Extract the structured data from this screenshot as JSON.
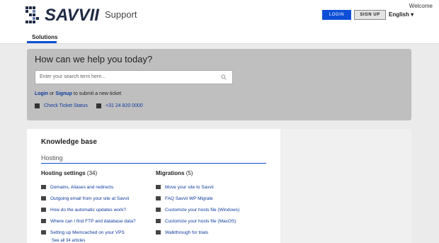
{
  "header": {
    "brand": "SAVVII",
    "section": "Support",
    "welcome": "Welcome",
    "login_label": "LOGIN",
    "signup_label": "SIGN UP",
    "language": "English",
    "tab": "Solutions"
  },
  "hero": {
    "title": "How can we help you today?",
    "search_placeholder": "Enter your search term here...",
    "login_link": "Login",
    "or": "or",
    "signup_link": "Signup",
    "submit_text": "to submit a new ticket",
    "check_ticket": "Check Ticket Status",
    "phone": "+31 24 820 0000"
  },
  "kb": {
    "title": "Knowledge base",
    "category": "Hosting",
    "col1": {
      "name": "Hosting settings",
      "count": "(34)",
      "articles": [
        "Domains, Aliases and redirects",
        "Outgoing email from your site at Savvii",
        "How do the automatic updates work?",
        "Where can I find FTP and database data?",
        "Setting up Memcached on your VPS"
      ],
      "see_all": "See all 34 articles"
    },
    "col2": {
      "name": "Migrations",
      "count": "(5)",
      "articles": [
        "Move your site to Savvii",
        "FAQ Savvii WP Migrate",
        "Customize your hosts file (Windows)",
        "Customize your hosts file (MacOS)",
        "Walkthrough for trials"
      ]
    }
  }
}
